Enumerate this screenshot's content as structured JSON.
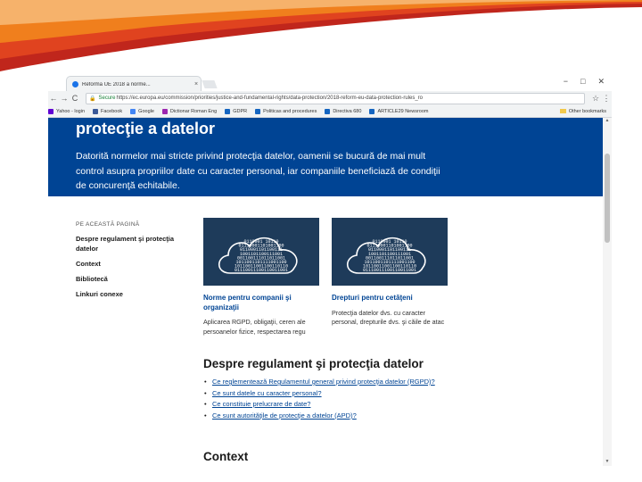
{
  "browser": {
    "tab_title": "Reforma UE 2018 a norme...",
    "tab_close": "×",
    "window_controls": [
      "−",
      "□",
      "✕"
    ],
    "nav": {
      "back": "←",
      "forward": "→",
      "reload": "C"
    },
    "address": {
      "secure_label": "Secure",
      "url": "https://ec.europa.eu/commission/priorities/justice-and-fundamental-rights/data-protection/2018-reform-eu-data-protection-rules_ro"
    },
    "bookmarks": [
      {
        "label": "Yahoo - login",
        "color": "#6001d2"
      },
      {
        "label": "Facebook",
        "color": "#3b5998"
      },
      {
        "label": "Google",
        "color": "#4285f4"
      },
      {
        "label": "Dictionar Roman Eng",
        "color": "#9c27b0"
      },
      {
        "label": "GDPR",
        "color": "#1565c0"
      },
      {
        "label": "Politicas and procedures",
        "color": "#1565c0"
      },
      {
        "label": "Directiva 680",
        "color": "#1565c0"
      },
      {
        "label": "ARTICLE29 Newsroom",
        "color": "#1565c0"
      }
    ],
    "other_bookmarks": "Other bookmarks"
  },
  "page": {
    "hero": {
      "title": "protecţie a datelor",
      "text": "Datorită normelor mai stricte privind protecţia datelor, oamenii se bucură de mai mult control asupra propriilor date cu caracter personal, iar companiile beneficiază de condiţii de concurenţă echitabile."
    },
    "sidenav": {
      "heading": "PE ACEASTĂ PAGINĂ",
      "items": [
        "Despre regulament şi protecţia datelor",
        "Context",
        "Bibliotecă",
        "Linkuri conexe"
      ]
    },
    "cards": [
      {
        "title": "Norme pentru companii şi organizaţii",
        "desc": "Aplicarea RGPD, obligaţii, ceren ale persoanelor fizice, respectarea regu"
      },
      {
        "title": "Drepturi pentru cetăţeni",
        "desc": "Protecţia datelor dvs. cu caracter personal, drepturile dvs. şi căile de atac"
      }
    ],
    "binary_art": [
      "0110001 10110",
      "01110001101001100",
      "0110001101100111",
      "1001101100111001",
      "001100111011011001",
      "1011001101111001100",
      "10110011001100110110",
      "01110011100110011001"
    ],
    "main_heading": "Despre regulament şi protecţia datelor",
    "links": [
      "Ce reglementează Regulamentul general privind protecţia datelor (RGPD)?",
      "Ce sunt datele cu caracter personal?",
      "Ce constituie prelucrare de date?",
      "Ce sunt autorităţile de protecţie a datelor (APD)?"
    ],
    "section_heading": "Context"
  },
  "scroll": {
    "up": "▲",
    "down": "▼"
  },
  "colors": {
    "hero_bg": "#004494",
    "link": "#004494",
    "card_image_bg": "#1e3b5a",
    "slide_accent_red": "#c0261c",
    "slide_accent_orange": "#f07f1d"
  }
}
